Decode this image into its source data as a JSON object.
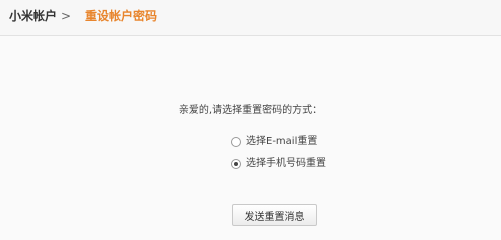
{
  "breadcrumb": {
    "root": "小米帐户",
    "separator": ">",
    "current": "重设帐户密码"
  },
  "form": {
    "prompt": "亲爱的,请选择重置密码的方式：",
    "options": [
      {
        "label": "选择E-mail重置",
        "selected": false
      },
      {
        "label": "选择手机号码重置",
        "selected": true
      }
    ],
    "submit_label": "发送重置消息"
  },
  "colors": {
    "accent": "#e8852d",
    "background": "#fafafa"
  }
}
